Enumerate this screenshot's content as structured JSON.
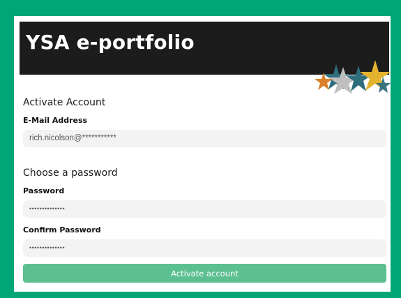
{
  "header": {
    "title": "YSA e-portfolio"
  },
  "form": {
    "section_heading": "Activate Account",
    "email": {
      "label": "E-Mail Address",
      "value": "rich.nicolson@***********"
    },
    "password_section_heading": "Choose a password",
    "password": {
      "label": "Password",
      "value": "••••••••••••••"
    },
    "confirm_password": {
      "label": "Confirm Password",
      "value": "••••••••••••••"
    },
    "submit_label": "Activate account"
  },
  "colors": {
    "frame_green": "#00a676",
    "header_dark": "#1c1c1c",
    "button_green": "#5cbf8f",
    "star_orange": "#d9822b",
    "star_teal": "#2f6e7d",
    "star_grey": "#bfbfbf",
    "star_yellow": "#e2b32f"
  },
  "icons": [
    "stars-logo-icon"
  ]
}
